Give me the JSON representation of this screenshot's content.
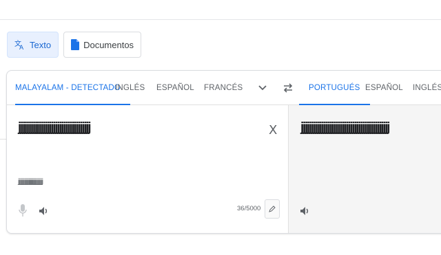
{
  "modes": {
    "text_label": "Texto",
    "documents_label": "Documentos"
  },
  "source_langs": {
    "detected": "MALAYALAM - DETECTADO",
    "items": [
      "INGLÉS",
      "ESPAÑOL",
      "FRANCÉS"
    ]
  },
  "target_langs": {
    "active": "PORTUGUÉS",
    "items": [
      "ESPAÑOL",
      "INGLÉS"
    ]
  },
  "source": {
    "text": "jjjjjjjjjjjjjjjjjjjjjjjjjjjjjjjjjjj",
    "transliteration": "jjjjjjjjjjjjjjjjjjjjjjjjjjjjjjjjjjj",
    "clear_glyph": "X",
    "char_count": "36/5000"
  },
  "target": {
    "text": "jjjjjjjjjjjjjjjjjjjjjjjjjjjjjjjjjjjjjjjjjjj"
  },
  "colors": {
    "accent": "#1a73e8",
    "active_bg": "#e8f0fe",
    "target_bg": "#f5f5f5"
  },
  "icons": [
    "translate-icon",
    "document-icon",
    "chevron-down-icon",
    "swap-icon",
    "microphone-icon",
    "speaker-icon",
    "edit-icon"
  ]
}
